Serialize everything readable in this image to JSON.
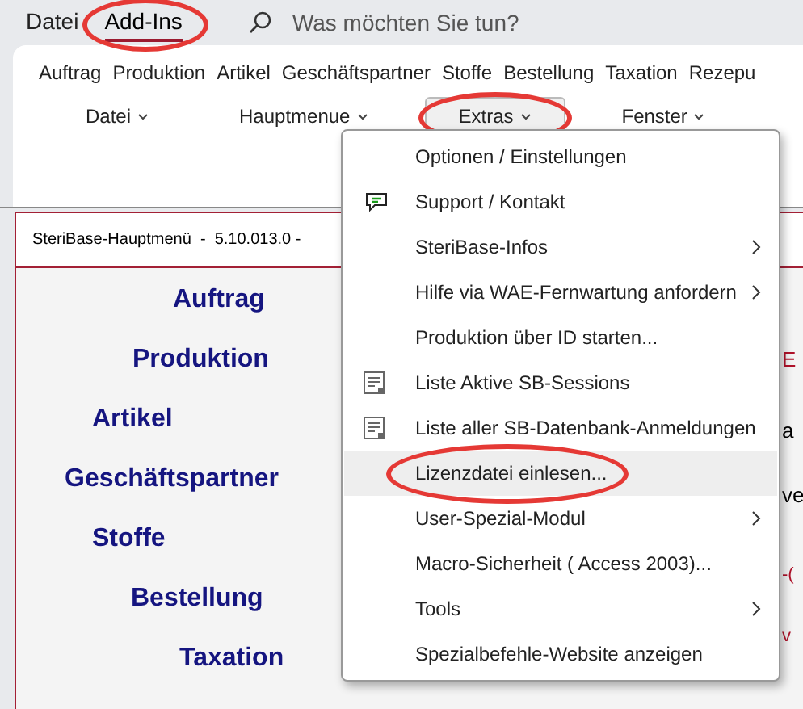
{
  "tabs": [
    {
      "label": "Datei",
      "selected": false,
      "highlighted": false
    },
    {
      "label": "Add-Ins",
      "selected": true,
      "highlighted": true
    }
  ],
  "search": {
    "placeholder": "Was möchten Sie tun?"
  },
  "ribbon": {
    "commands": [
      "Auftrag",
      "Produktion",
      "Artikel",
      "Geschäftspartner",
      "Stoffe",
      "Bestellung",
      "Taxation",
      "Rezepu"
    ],
    "menus": [
      {
        "label": "Datei",
        "open": false,
        "highlighted": false
      },
      {
        "label": "Hauptmenue",
        "open": false,
        "highlighted": false
      },
      {
        "label": "Extras",
        "open": true,
        "highlighted": true
      },
      {
        "label": "Fenster",
        "open": false,
        "highlighted": false
      }
    ]
  },
  "document": {
    "title": "SteriBase-Hauptmenü  -  5.10.013.0 -",
    "nav_items": [
      "Auftrag",
      "Produktion",
      "Artikel",
      "Geschäftspartner",
      "Stoffe",
      "Bestellung",
      "Taxation"
    ],
    "fragments": [
      {
        "text": "E",
        "kind": "heading"
      },
      {
        "text": "a",
        "kind": "large"
      },
      {
        "text": "ve",
        "kind": "large"
      },
      {
        "text": "-(",
        "kind": "note"
      },
      {
        "text": "v",
        "kind": "note"
      }
    ]
  },
  "dropdown": {
    "items": [
      {
        "label": "Optionen / Einstellungen",
        "kind": "plain",
        "submenu": false,
        "hovered": false,
        "highlighted": false
      },
      {
        "label": "Support / Kontakt",
        "kind": "speech",
        "submenu": false,
        "hovered": false,
        "highlighted": false
      },
      {
        "label": "SteriBase-Infos",
        "kind": "plain",
        "submenu": true,
        "hovered": false,
        "highlighted": false
      },
      {
        "label": "Hilfe via WAE-Fernwartung anfordern",
        "kind": "plain",
        "submenu": true,
        "hovered": false,
        "highlighted": false
      },
      {
        "label": "Produktion über ID starten...",
        "kind": "plain",
        "submenu": false,
        "hovered": false,
        "highlighted": false
      },
      {
        "label": "Liste Aktive SB-Sessions",
        "kind": "list",
        "submenu": false,
        "hovered": false,
        "highlighted": false
      },
      {
        "label": "Liste aller SB-Datenbank-Anmeldungen",
        "kind": "list",
        "submenu": false,
        "hovered": false,
        "highlighted": false
      },
      {
        "label": "Lizenzdatei einlesen...",
        "kind": "plain",
        "submenu": false,
        "hovered": true,
        "highlighted": true
      },
      {
        "label": "User-Spezial-Modul",
        "kind": "plain",
        "submenu": true,
        "hovered": false,
        "highlighted": false
      },
      {
        "label": "Macro-Sicherheit ( Access 2003)...",
        "kind": "plain",
        "submenu": false,
        "hovered": false,
        "highlighted": false
      },
      {
        "label": "Tools",
        "kind": "plain",
        "submenu": true,
        "hovered": false,
        "highlighted": false
      },
      {
        "label": "Spezialbefehle-Website anzeigen",
        "kind": "plain",
        "submenu": false,
        "hovered": false,
        "highlighted": false
      }
    ]
  }
}
